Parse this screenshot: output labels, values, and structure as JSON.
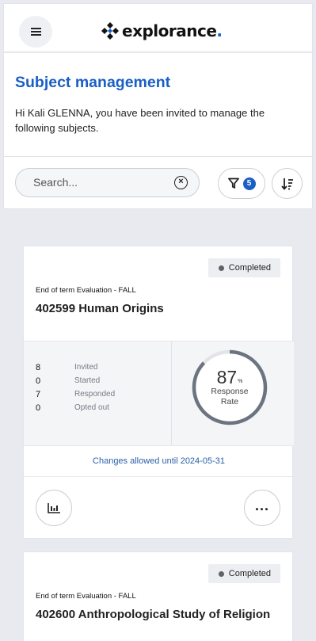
{
  "header": {
    "menu_icon": "hamburger-icon",
    "logo_text": "explorance",
    "logo_dot": ".",
    "logo_mark": "explorance-diamond-logo"
  },
  "intro": {
    "title": "Subject management",
    "message": "Hi Kali GLENNA, you have been invited to manage the following subjects."
  },
  "toolbar": {
    "search_placeholder": "Search...",
    "search_value": "",
    "clear_icon": "clear-circle-icon",
    "filter_icon": "filter-icon",
    "filter_count": "5",
    "sort_icon": "sort-descending-icon"
  },
  "colors": {
    "brand": "#1a5fc4",
    "ring_track": "#e2e4e8",
    "ring_fill": "#6b7480",
    "link": "#2a5fa8"
  },
  "cards": [
    {
      "status": "Completed",
      "evaluation": "End of term Evaluation - FALL",
      "title": "402599 Human Origins",
      "stats": [
        {
          "value": "8",
          "label": "Invited"
        },
        {
          "value": "0",
          "label": "Started"
        },
        {
          "value": "7",
          "label": "Responded"
        },
        {
          "value": "0",
          "label": "Opted out"
        }
      ],
      "response_rate_value": "87",
      "response_rate_unit": "%",
      "response_rate_label": "Response Rate",
      "response_rate_fraction": 0.87,
      "changes_text": "Changes allowed until 2024-05-31",
      "report_icon": "bar-chart-report-icon",
      "more_icon": "more-horizontal-icon"
    },
    {
      "status": "Completed",
      "evaluation": "End of term Evaluation - FALL",
      "title": "402600 Anthropological Study of Religion"
    }
  ]
}
